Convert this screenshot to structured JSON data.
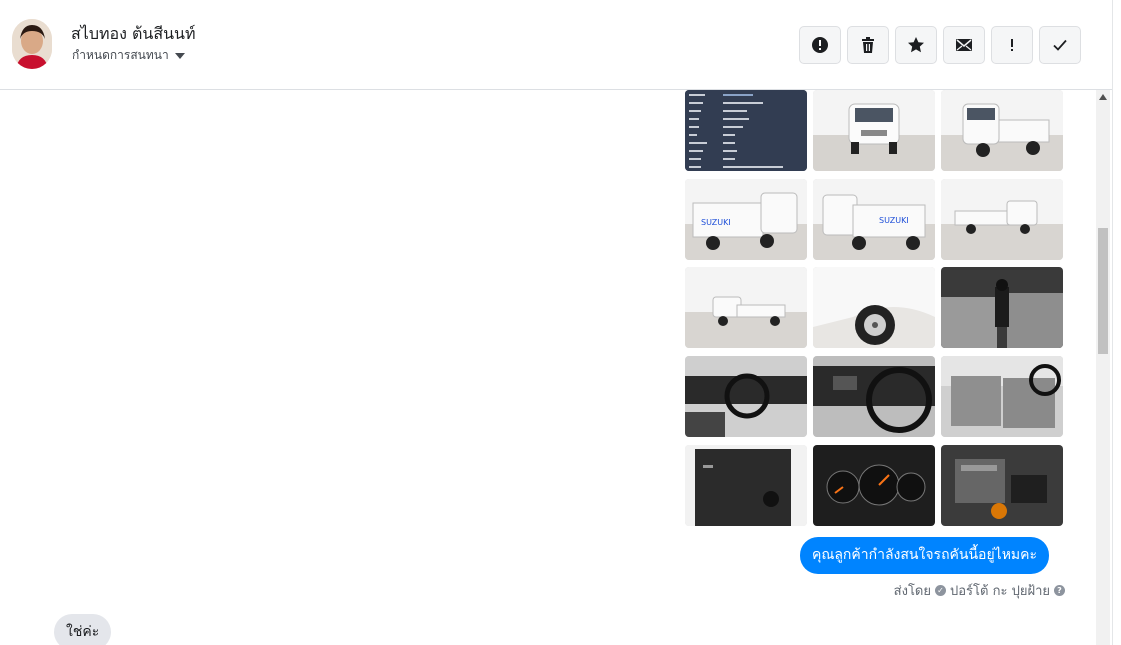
{
  "header": {
    "contact_name": "สไบทอง ต้นสีนนท์",
    "conversation_label": "กำหนดการสนทนา",
    "actions": [
      {
        "name": "report-button",
        "icon": "alert-circle-icon"
      },
      {
        "name": "delete-button",
        "icon": "trash-icon"
      },
      {
        "name": "star-button",
        "icon": "star-icon"
      },
      {
        "name": "mark-unread-button",
        "icon": "envelope-icon"
      },
      {
        "name": "important-button",
        "icon": "exclamation-icon"
      },
      {
        "name": "done-button",
        "icon": "check-icon"
      }
    ]
  },
  "messages": {
    "outgoing_text": "คุณลูกค้ากำลังสนใจรถคันนี้อยู่ไหมคะ",
    "sent_by_prefix": "ส่งโดย",
    "sent_by_name": "ปอร์โต้ กะ ปุยฝ้าย",
    "incoming_text": "ใช่ค่ะ"
  },
  "gallery": {
    "photos": [
      "spec-sheet",
      "truck-front",
      "truck-front-angle",
      "truck-rear-angle",
      "truck-rear",
      "truck-side-right",
      "truck-side-left",
      "wheel-closeup",
      "gear-shift",
      "dashboard-left",
      "steering-wheel",
      "seats",
      "door-panel",
      "gauge-cluster",
      "engine-bay"
    ]
  },
  "colors": {
    "accent": "#0084ff",
    "incoming_bubble": "#e4e6eb"
  }
}
